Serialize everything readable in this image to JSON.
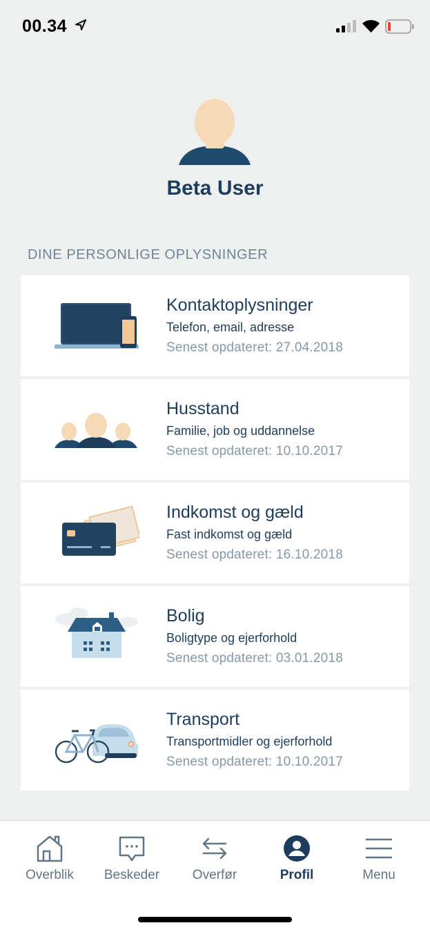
{
  "status_bar": {
    "time": "00.34"
  },
  "profile": {
    "name": "Beta User"
  },
  "section": {
    "heading": "DINE PERSONLIGE OPLYSNINGER"
  },
  "cards": [
    {
      "icon": "laptop-phone-icon",
      "title": "Kontaktoplysninger",
      "subtitle": "Telefon, email, adresse",
      "updated": "Senest opdateret: 27.04.2018"
    },
    {
      "icon": "household-icon",
      "title": "Husstand",
      "subtitle": "Familie, job og uddannelse",
      "updated": "Senest opdateret: 10.10.2017"
    },
    {
      "icon": "credit-card-icon",
      "title": "Indkomst og gæld",
      "subtitle": "Fast indkomst og gæld",
      "updated": "Senest opdateret: 16.10.2018"
    },
    {
      "icon": "house-icon",
      "title": "Bolig",
      "subtitle": "Boligtype og ejerforhold",
      "updated": "Senest opdateret: 03.01.2018"
    },
    {
      "icon": "bicycle-car-icon",
      "title": "Transport",
      "subtitle": "Transportmidler og ejerforhold",
      "updated": "Senest opdateret: 10.10.2017"
    }
  ],
  "tabs": [
    {
      "label": "Overblik",
      "icon": "home-icon",
      "active": false
    },
    {
      "label": "Beskeder",
      "icon": "message-icon",
      "active": false
    },
    {
      "label": "Overfør",
      "icon": "transfer-icon",
      "active": false
    },
    {
      "label": "Profil",
      "icon": "profile-icon",
      "active": true
    },
    {
      "label": "Menu",
      "icon": "menu-icon",
      "active": false
    }
  ],
  "colors": {
    "navy": "#1e3d5c",
    "skin": "#f6d9b7",
    "background": "#eeefef",
    "muted": "#8598a8"
  }
}
